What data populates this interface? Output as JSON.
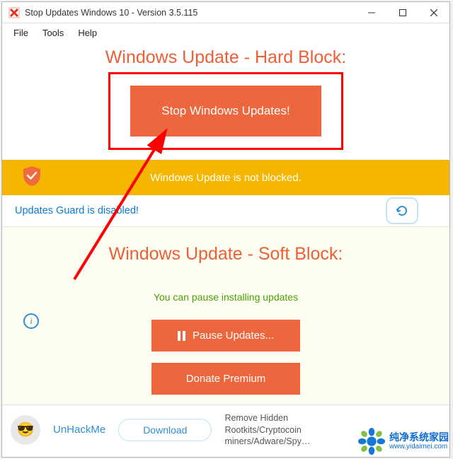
{
  "titlebar": {
    "title": "Stop Updates Windows 10 - Version 3.5.115"
  },
  "menubar": {
    "file": "File",
    "tools": "Tools",
    "help": "Help"
  },
  "hard": {
    "heading": "Windows Update - Hard Block:",
    "button": "Stop Windows Updates!"
  },
  "status": {
    "text": "Windows Update is not blocked."
  },
  "guard": {
    "text": "Updates Guard is disabled!"
  },
  "soft": {
    "heading": "Windows Update - Soft Block:",
    "note": "You can pause installing updates",
    "info_glyph": "i",
    "pause": "Pause Updates...",
    "donate": "Donate Premium"
  },
  "promo": {
    "avatar_glyph": "😎",
    "name": "UnHackMe",
    "download": "Download",
    "desc": "Remove Hidden Rootkits/Cryptocoin miners/Adware/Spy…"
  },
  "watermark": {
    "cn": "纯净系统家园",
    "url": "www.yidaimei.com"
  },
  "colors": {
    "accent": "#ee663d",
    "warning_bg": "#f5b600",
    "link": "#2d8fd8",
    "highlight_border": "#ff0000"
  }
}
